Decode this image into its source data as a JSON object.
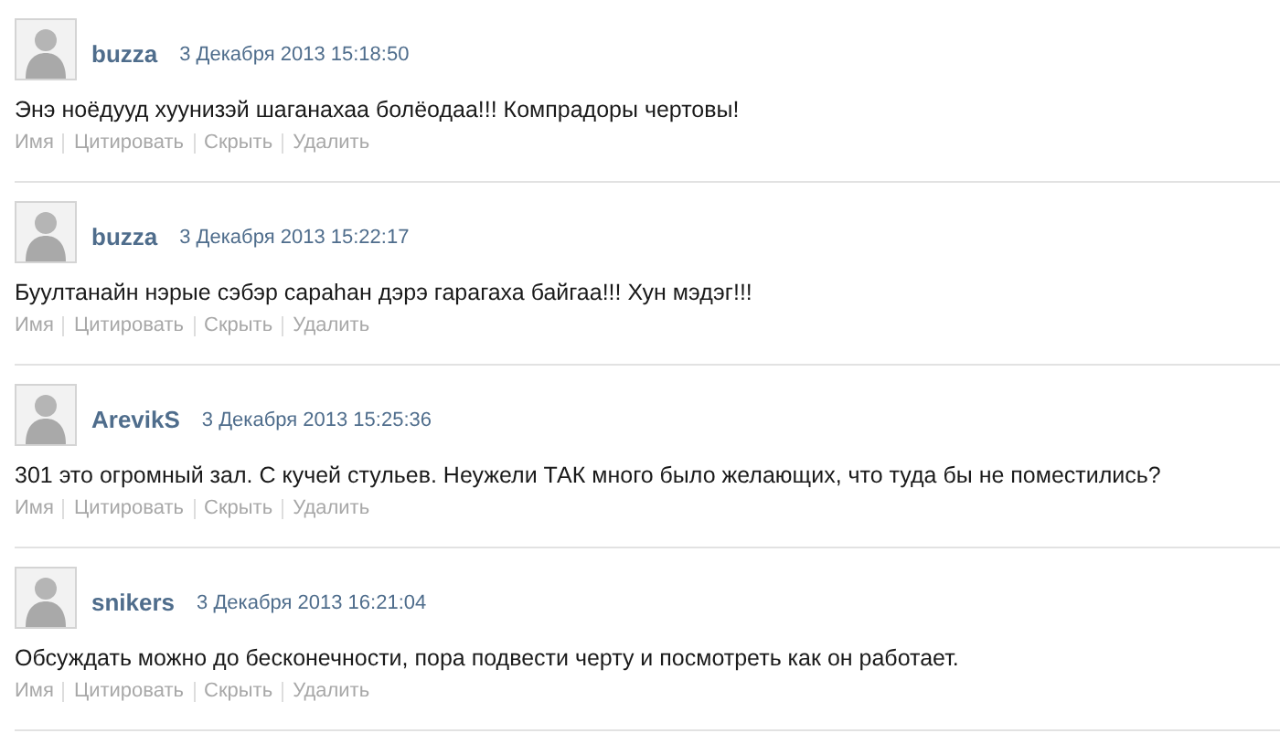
{
  "comments": [
    {
      "author": "buzza",
      "date": "3 Декабря 2013 15:18:50",
      "text": "Энэ ноёдууд хуунизэй шаганахаа болёодаа!!! Компрадоры чертовы!",
      "actions": [
        "Имя",
        "Цитировать",
        "Скрыть",
        "Удалить"
      ]
    },
    {
      "author": "buzza",
      "date": "3 Декабря 2013 15:22:17",
      "text": "Буултанайн нэрые сэбэр сараhан дэрэ гарагаха байгаа!!! Хун мэдэг!!!",
      "actions": [
        "Имя",
        "Цитировать",
        "Скрыть",
        "Удалить"
      ]
    },
    {
      "author": "ArevikS",
      "date": "3 Декабря 2013 15:25:36",
      "text": "301 это огромный зал. С кучей стульев. Неужели ТАК много было желающих, что туда бы не поместились?",
      "actions": [
        "Имя",
        "Цитировать",
        "Скрыть",
        "Удалить"
      ]
    },
    {
      "author": "snikers",
      "date": "3 Декабря 2013 16:21:04",
      "text": "Обсуждать можно до бесконечности, пора подвести черту и посмотреть как он работает.",
      "actions": [
        "Имя",
        "Цитировать",
        "Скрыть",
        "Удалить"
      ]
    }
  ]
}
